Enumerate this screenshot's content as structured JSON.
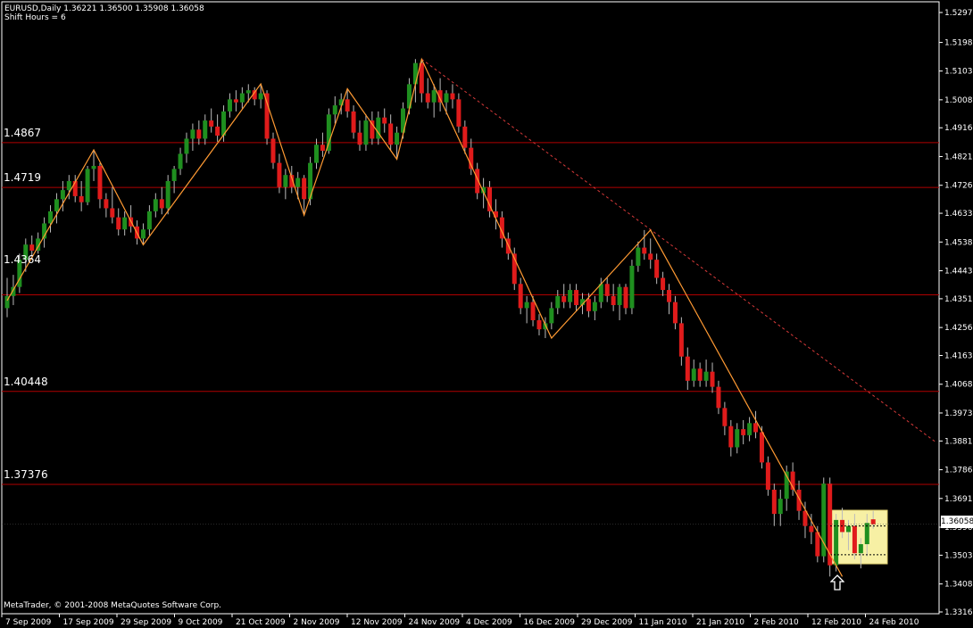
{
  "header": {
    "symbol_line": "EURUSD,Daily  1.36221 1.36500 1.35908 1.36058",
    "shift_line": "Shift Hours = 6"
  },
  "footer": {
    "copyright": "MetaTrader, © 2001-2008 MetaQuotes Software Corp."
  },
  "colors": {
    "background": "#000000",
    "axis": "#ffffff",
    "bull": "#1f8f1f",
    "bear": "#e01b1b",
    "level_line": "#b00000",
    "zigzag": "#ff9a33",
    "trendline": "#d83a3a",
    "highlight": "#f7f0a4"
  },
  "chart_data": {
    "type": "candlestick",
    "symbol": "EURUSD",
    "timeframe": "Daily",
    "ohlc_current": {
      "open": 1.36221,
      "high": 1.365,
      "low": 1.35908,
      "close": 1.36058
    },
    "y_ticks": [
      "1.52970",
      "1.51980",
      "1.51035",
      "1.50085",
      "1.49160",
      "1.48210",
      "1.47260",
      "1.46335",
      "1.45385",
      "1.44435",
      "1.43510",
      "1.42560",
      "1.41635",
      "1.40685",
      "1.39735",
      "1.38810",
      "1.37860",
      "1.36910",
      "1.35960",
      "1.35035",
      "1.34085",
      "1.33160"
    ],
    "x_ticks": [
      "7 Sep 2009",
      "17 Sep 2009",
      "29 Sep 2009",
      "9 Oct 2009",
      "21 Oct 2009",
      "2 Nov 2009",
      "12 Nov 2009",
      "24 Nov 2009",
      "4 Dec 2009",
      "16 Dec 2009",
      "29 Dec 2009",
      "11 Jan 2010",
      "21 Jan 2010",
      "2 Feb 2010",
      "12 Feb 2010",
      "24 Feb 2010"
    ],
    "ylim": [
      1.3316,
      1.5297
    ],
    "current_price": "1.36058",
    "levels": [
      "1.4867",
      "1.4719",
      "1.4364",
      "1.40448",
      "1.37376"
    ],
    "zigzag": [
      {
        "i": 0,
        "p": 1.4345
      },
      {
        "i": 14,
        "p": 1.4843
      },
      {
        "i": 22,
        "p": 1.4529
      },
      {
        "i": 41,
        "p": 1.5061
      },
      {
        "i": 48,
        "p": 1.4627
      },
      {
        "i": 55,
        "p": 1.5045
      },
      {
        "i": 63,
        "p": 1.4812
      },
      {
        "i": 67,
        "p": 1.5143
      },
      {
        "i": 88,
        "p": 1.4221
      },
      {
        "i": 104,
        "p": 1.4578
      },
      {
        "i": 135,
        "p": 1.3433
      }
    ],
    "trendline": {
      "start": {
        "i": 67,
        "p": 1.5143
      },
      "end": {
        "i": 150,
        "p": 1.3879
      }
    },
    "candles": [
      {
        "o": 1.432,
        "h": 1.442,
        "l": 1.429,
        "c": 1.436
      },
      {
        "o": 1.436,
        "h": 1.443,
        "l": 1.433,
        "c": 1.439
      },
      {
        "o": 1.439,
        "h": 1.45,
        "l": 1.437,
        "c": 1.448
      },
      {
        "o": 1.448,
        "h": 1.455,
        "l": 1.444,
        "c": 1.453
      },
      {
        "o": 1.453,
        "h": 1.456,
        "l": 1.448,
        "c": 1.451
      },
      {
        "o": 1.451,
        "h": 1.457,
        "l": 1.45,
        "c": 1.455
      },
      {
        "o": 1.455,
        "h": 1.462,
        "l": 1.452,
        "c": 1.46
      },
      {
        "o": 1.46,
        "h": 1.466,
        "l": 1.457,
        "c": 1.464
      },
      {
        "o": 1.464,
        "h": 1.47,
        "l": 1.46,
        "c": 1.468
      },
      {
        "o": 1.468,
        "h": 1.474,
        "l": 1.464,
        "c": 1.471
      },
      {
        "o": 1.471,
        "h": 1.476,
        "l": 1.468,
        "c": 1.474
      },
      {
        "o": 1.474,
        "h": 1.476,
        "l": 1.467,
        "c": 1.469
      },
      {
        "o": 1.469,
        "h": 1.474,
        "l": 1.464,
        "c": 1.467
      },
      {
        "o": 1.467,
        "h": 1.479,
        "l": 1.466,
        "c": 1.478
      },
      {
        "o": 1.478,
        "h": 1.4843,
        "l": 1.474,
        "c": 1.479
      },
      {
        "o": 1.479,
        "h": 1.48,
        "l": 1.465,
        "c": 1.468
      },
      {
        "o": 1.468,
        "h": 1.47,
        "l": 1.462,
        "c": 1.465
      },
      {
        "o": 1.465,
        "h": 1.472,
        "l": 1.46,
        "c": 1.462
      },
      {
        "o": 1.462,
        "h": 1.465,
        "l": 1.456,
        "c": 1.458
      },
      {
        "o": 1.458,
        "h": 1.464,
        "l": 1.456,
        "c": 1.462
      },
      {
        "o": 1.462,
        "h": 1.466,
        "l": 1.457,
        "c": 1.459
      },
      {
        "o": 1.459,
        "h": 1.461,
        "l": 1.453,
        "c": 1.455
      },
      {
        "o": 1.455,
        "h": 1.46,
        "l": 1.4529,
        "c": 1.458
      },
      {
        "o": 1.458,
        "h": 1.466,
        "l": 1.456,
        "c": 1.464
      },
      {
        "o": 1.464,
        "h": 1.47,
        "l": 1.462,
        "c": 1.468
      },
      {
        "o": 1.468,
        "h": 1.472,
        "l": 1.463,
        "c": 1.465
      },
      {
        "o": 1.465,
        "h": 1.476,
        "l": 1.463,
        "c": 1.474
      },
      {
        "o": 1.474,
        "h": 1.479,
        "l": 1.47,
        "c": 1.478
      },
      {
        "o": 1.478,
        "h": 1.485,
        "l": 1.476,
        "c": 1.483
      },
      {
        "o": 1.483,
        "h": 1.49,
        "l": 1.48,
        "c": 1.488
      },
      {
        "o": 1.488,
        "h": 1.493,
        "l": 1.484,
        "c": 1.491
      },
      {
        "o": 1.491,
        "h": 1.494,
        "l": 1.486,
        "c": 1.488
      },
      {
        "o": 1.488,
        "h": 1.496,
        "l": 1.486,
        "c": 1.494
      },
      {
        "o": 1.494,
        "h": 1.498,
        "l": 1.49,
        "c": 1.492
      },
      {
        "o": 1.492,
        "h": 1.496,
        "l": 1.487,
        "c": 1.489
      },
      {
        "o": 1.489,
        "h": 1.499,
        "l": 1.487,
        "c": 1.497
      },
      {
        "o": 1.497,
        "h": 1.503,
        "l": 1.495,
        "c": 1.501
      },
      {
        "o": 1.501,
        "h": 1.504,
        "l": 1.497,
        "c": 1.5
      },
      {
        "o": 1.5,
        "h": 1.505,
        "l": 1.498,
        "c": 1.503
      },
      {
        "o": 1.503,
        "h": 1.506,
        "l": 1.5,
        "c": 1.504
      },
      {
        "o": 1.504,
        "h": 1.505,
        "l": 1.499,
        "c": 1.501
      },
      {
        "o": 1.501,
        "h": 1.5061,
        "l": 1.498,
        "c": 1.503
      },
      {
        "o": 1.503,
        "h": 1.504,
        "l": 1.486,
        "c": 1.488
      },
      {
        "o": 1.488,
        "h": 1.49,
        "l": 1.478,
        "c": 1.48
      },
      {
        "o": 1.48,
        "h": 1.483,
        "l": 1.47,
        "c": 1.472
      },
      {
        "o": 1.472,
        "h": 1.478,
        "l": 1.468,
        "c": 1.476
      },
      {
        "o": 1.476,
        "h": 1.479,
        "l": 1.47,
        "c": 1.472
      },
      {
        "o": 1.472,
        "h": 1.477,
        "l": 1.468,
        "c": 1.475
      },
      {
        "o": 1.475,
        "h": 1.476,
        "l": 1.4627,
        "c": 1.468
      },
      {
        "o": 1.468,
        "h": 1.482,
        "l": 1.466,
        "c": 1.48
      },
      {
        "o": 1.48,
        "h": 1.488,
        "l": 1.478,
        "c": 1.486
      },
      {
        "o": 1.486,
        "h": 1.49,
        "l": 1.482,
        "c": 1.484
      },
      {
        "o": 1.484,
        "h": 1.498,
        "l": 1.483,
        "c": 1.496
      },
      {
        "o": 1.496,
        "h": 1.502,
        "l": 1.493,
        "c": 1.499
      },
      {
        "o": 1.499,
        "h": 1.503,
        "l": 1.496,
        "c": 1.501
      },
      {
        "o": 1.501,
        "h": 1.5045,
        "l": 1.495,
        "c": 1.497
      },
      {
        "o": 1.497,
        "h": 1.499,
        "l": 1.488,
        "c": 1.49
      },
      {
        "o": 1.49,
        "h": 1.494,
        "l": 1.484,
        "c": 1.486
      },
      {
        "o": 1.486,
        "h": 1.496,
        "l": 1.484,
        "c": 1.494
      },
      {
        "o": 1.494,
        "h": 1.497,
        "l": 1.486,
        "c": 1.488
      },
      {
        "o": 1.488,
        "h": 1.497,
        "l": 1.486,
        "c": 1.495
      },
      {
        "o": 1.495,
        "h": 1.498,
        "l": 1.49,
        "c": 1.493
      },
      {
        "o": 1.493,
        "h": 1.496,
        "l": 1.484,
        "c": 1.486
      },
      {
        "o": 1.486,
        "h": 1.492,
        "l": 1.4812,
        "c": 1.49
      },
      {
        "o": 1.49,
        "h": 1.5,
        "l": 1.488,
        "c": 1.498
      },
      {
        "o": 1.498,
        "h": 1.508,
        "l": 1.496,
        "c": 1.506
      },
      {
        "o": 1.506,
        "h": 1.5143,
        "l": 1.5,
        "c": 1.513
      },
      {
        "o": 1.513,
        "h": 1.5143,
        "l": 1.5,
        "c": 1.503
      },
      {
        "o": 1.503,
        "h": 1.508,
        "l": 1.498,
        "c": 1.5
      },
      {
        "o": 1.5,
        "h": 1.506,
        "l": 1.495,
        "c": 1.504
      },
      {
        "o": 1.504,
        "h": 1.508,
        "l": 1.497,
        "c": 1.5
      },
      {
        "o": 1.5,
        "h": 1.504,
        "l": 1.496,
        "c": 1.503
      },
      {
        "o": 1.503,
        "h": 1.506,
        "l": 1.498,
        "c": 1.501
      },
      {
        "o": 1.501,
        "h": 1.503,
        "l": 1.49,
        "c": 1.492
      },
      {
        "o": 1.492,
        "h": 1.494,
        "l": 1.483,
        "c": 1.485
      },
      {
        "o": 1.485,
        "h": 1.488,
        "l": 1.476,
        "c": 1.478
      },
      {
        "o": 1.478,
        "h": 1.48,
        "l": 1.468,
        "c": 1.47
      },
      {
        "o": 1.47,
        "h": 1.475,
        "l": 1.465,
        "c": 1.472
      },
      {
        "o": 1.472,
        "h": 1.474,
        "l": 1.462,
        "c": 1.464
      },
      {
        "o": 1.464,
        "h": 1.468,
        "l": 1.458,
        "c": 1.462
      },
      {
        "o": 1.462,
        "h": 1.464,
        "l": 1.452,
        "c": 1.455
      },
      {
        "o": 1.455,
        "h": 1.457,
        "l": 1.448,
        "c": 1.45
      },
      {
        "o": 1.45,
        "h": 1.452,
        "l": 1.438,
        "c": 1.44
      },
      {
        "o": 1.44,
        "h": 1.442,
        "l": 1.43,
        "c": 1.432
      },
      {
        "o": 1.432,
        "h": 1.436,
        "l": 1.427,
        "c": 1.434
      },
      {
        "o": 1.434,
        "h": 1.436,
        "l": 1.426,
        "c": 1.428
      },
      {
        "o": 1.428,
        "h": 1.43,
        "l": 1.423,
        "c": 1.425
      },
      {
        "o": 1.425,
        "h": 1.429,
        "l": 1.4221,
        "c": 1.427
      },
      {
        "o": 1.427,
        "h": 1.434,
        "l": 1.425,
        "c": 1.432
      },
      {
        "o": 1.432,
        "h": 1.438,
        "l": 1.43,
        "c": 1.436
      },
      {
        "o": 1.436,
        "h": 1.44,
        "l": 1.432,
        "c": 1.434
      },
      {
        "o": 1.434,
        "h": 1.44,
        "l": 1.432,
        "c": 1.438
      },
      {
        "o": 1.438,
        "h": 1.44,
        "l": 1.431,
        "c": 1.433
      },
      {
        "o": 1.433,
        "h": 1.437,
        "l": 1.43,
        "c": 1.435
      },
      {
        "o": 1.435,
        "h": 1.437,
        "l": 1.429,
        "c": 1.431
      },
      {
        "o": 1.431,
        "h": 1.436,
        "l": 1.428,
        "c": 1.434
      },
      {
        "o": 1.434,
        "h": 1.442,
        "l": 1.432,
        "c": 1.44
      },
      {
        "o": 1.44,
        "h": 1.442,
        "l": 1.434,
        "c": 1.436
      },
      {
        "o": 1.436,
        "h": 1.44,
        "l": 1.431,
        "c": 1.433
      },
      {
        "o": 1.433,
        "h": 1.44,
        "l": 1.428,
        "c": 1.439
      },
      {
        "o": 1.439,
        "h": 1.44,
        "l": 1.43,
        "c": 1.432
      },
      {
        "o": 1.432,
        "h": 1.448,
        "l": 1.43,
        "c": 1.446
      },
      {
        "o": 1.446,
        "h": 1.454,
        "l": 1.444,
        "c": 1.452
      },
      {
        "o": 1.452,
        "h": 1.4578,
        "l": 1.448,
        "c": 1.45
      },
      {
        "o": 1.45,
        "h": 1.455,
        "l": 1.445,
        "c": 1.448
      },
      {
        "o": 1.448,
        "h": 1.45,
        "l": 1.44,
        "c": 1.442
      },
      {
        "o": 1.442,
        "h": 1.444,
        "l": 1.436,
        "c": 1.438
      },
      {
        "o": 1.438,
        "h": 1.44,
        "l": 1.43,
        "c": 1.434
      },
      {
        "o": 1.434,
        "h": 1.436,
        "l": 1.425,
        "c": 1.427
      },
      {
        "o": 1.427,
        "h": 1.429,
        "l": 1.413,
        "c": 1.416
      },
      {
        "o": 1.416,
        "h": 1.419,
        "l": 1.405,
        "c": 1.408
      },
      {
        "o": 1.408,
        "h": 1.415,
        "l": 1.406,
        "c": 1.412
      },
      {
        "o": 1.412,
        "h": 1.414,
        "l": 1.406,
        "c": 1.408
      },
      {
        "o": 1.408,
        "h": 1.415,
        "l": 1.406,
        "c": 1.411
      },
      {
        "o": 1.411,
        "h": 1.414,
        "l": 1.404,
        "c": 1.406
      },
      {
        "o": 1.406,
        "h": 1.408,
        "l": 1.397,
        "c": 1.399
      },
      {
        "o": 1.399,
        "h": 1.401,
        "l": 1.39,
        "c": 1.393
      },
      {
        "o": 1.393,
        "h": 1.395,
        "l": 1.383,
        "c": 1.386
      },
      {
        "o": 1.386,
        "h": 1.394,
        "l": 1.384,
        "c": 1.392
      },
      {
        "o": 1.392,
        "h": 1.395,
        "l": 1.387,
        "c": 1.39
      },
      {
        "o": 1.39,
        "h": 1.396,
        "l": 1.388,
        "c": 1.394
      },
      {
        "o": 1.394,
        "h": 1.398,
        "l": 1.389,
        "c": 1.391
      },
      {
        "o": 1.391,
        "h": 1.393,
        "l": 1.379,
        "c": 1.381
      },
      {
        "o": 1.381,
        "h": 1.383,
        "l": 1.37,
        "c": 1.372
      },
      {
        "o": 1.372,
        "h": 1.374,
        "l": 1.36,
        "c": 1.364
      },
      {
        "o": 1.364,
        "h": 1.372,
        "l": 1.36,
        "c": 1.369
      },
      {
        "o": 1.369,
        "h": 1.38,
        "l": 1.365,
        "c": 1.378
      },
      {
        "o": 1.378,
        "h": 1.381,
        "l": 1.37,
        "c": 1.372
      },
      {
        "o": 1.372,
        "h": 1.375,
        "l": 1.362,
        "c": 1.365
      },
      {
        "o": 1.365,
        "h": 1.368,
        "l": 1.356,
        "c": 1.36
      },
      {
        "o": 1.36,
        "h": 1.364,
        "l": 1.354,
        "c": 1.358
      },
      {
        "o": 1.358,
        "h": 1.36,
        "l": 1.348,
        "c": 1.35
      },
      {
        "o": 1.35,
        "h": 1.376,
        "l": 1.348,
        "c": 1.374
      },
      {
        "o": 1.374,
        "h": 1.376,
        "l": 1.3433,
        "c": 1.347
      },
      {
        "o": 1.347,
        "h": 1.364,
        "l": 1.345,
        "c": 1.362
      },
      {
        "o": 1.362,
        "h": 1.366,
        "l": 1.356,
        "c": 1.358
      },
      {
        "o": 1.358,
        "h": 1.362,
        "l": 1.352,
        "c": 1.36
      },
      {
        "o": 1.36,
        "h": 1.364,
        "l": 1.349,
        "c": 1.351
      },
      {
        "o": 1.351,
        "h": 1.356,
        "l": 1.346,
        "c": 1.354
      },
      {
        "o": 1.354,
        "h": 1.364,
        "l": 1.35,
        "c": 1.361
      },
      {
        "o": 1.36221,
        "h": 1.365,
        "l": 1.35908,
        "c": 1.36058
      }
    ]
  }
}
